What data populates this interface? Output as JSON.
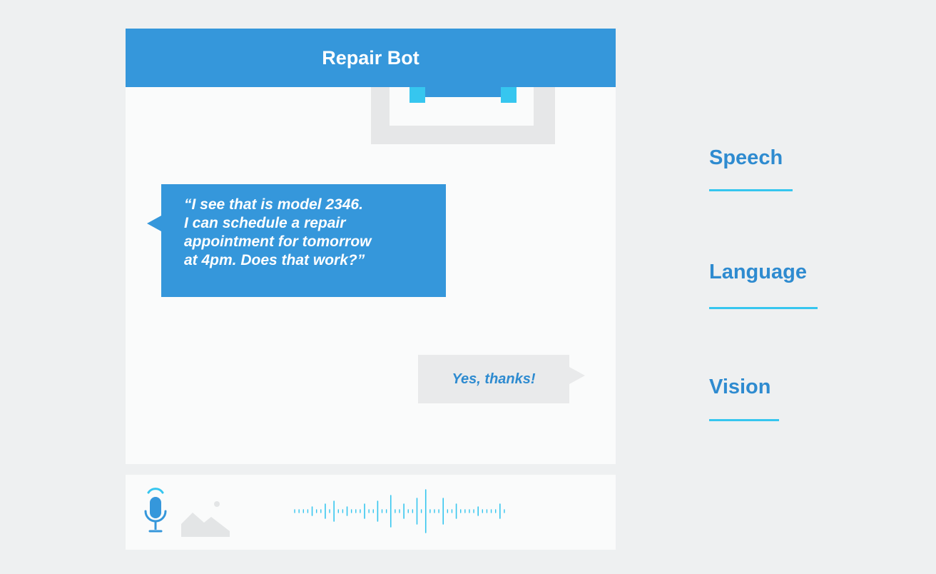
{
  "app": {
    "title": "Repair Bot"
  },
  "conversation": {
    "bot_message_lines": [
      "“I see that is model 2346.",
      "I can schedule a repair",
      "appointment for tomorrow",
      "at 4pm. Does that work?”"
    ],
    "user_message": "Yes, thanks!"
  },
  "input_bar": {
    "icons": [
      "microphone-icon",
      "image-icon",
      "audio-waveform"
    ]
  },
  "capabilities": [
    {
      "label": "Speech"
    },
    {
      "label": "Language"
    },
    {
      "label": "Vision"
    }
  ],
  "colors": {
    "accent": "#3597db",
    "highlight": "#36c6ef",
    "text_accent": "#2e8bd0",
    "background": "#eef0f1",
    "panel": "#fafbfb",
    "muted": "#e6e7e8"
  }
}
